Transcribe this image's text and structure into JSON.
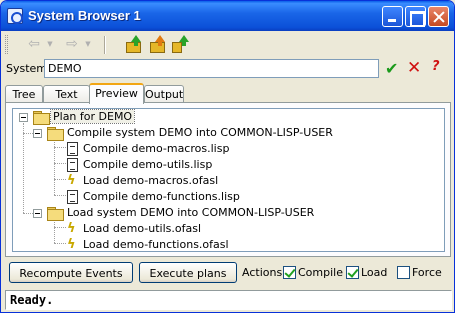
{
  "window": {
    "title": "System Browser 1"
  },
  "toolbar": {
    "back_icon": "back-arrow-icon",
    "forward_icon": "forward-arrow-icon",
    "tools": [
      "compile-system-icon",
      "load-system-icon",
      "compile-load-icon"
    ]
  },
  "system": {
    "label": "System:",
    "value": "DEMO"
  },
  "tabs": [
    {
      "label": "Tree",
      "active": false
    },
    {
      "label": "Text",
      "active": false
    },
    {
      "label": "Preview",
      "active": true
    },
    {
      "label": "Output",
      "active": false
    }
  ],
  "plan": {
    "root": "Plan for DEMO",
    "groups": [
      {
        "label": "Compile system DEMO into COMMON-LISP-USER",
        "items": [
          {
            "label": "Compile demo-macros.lisp",
            "kind": "compile"
          },
          {
            "label": "Compile demo-utils.lisp",
            "kind": "compile"
          },
          {
            "label": "Load demo-macros.ofasl",
            "kind": "load"
          },
          {
            "label": "Compile demo-functions.lisp",
            "kind": "compile"
          }
        ]
      },
      {
        "label": "Load system DEMO into COMMON-LISP-USER",
        "items": [
          {
            "label": "Load demo-utils.ofasl",
            "kind": "load"
          },
          {
            "label": "Load demo-functions.ofasl",
            "kind": "load"
          }
        ]
      }
    ]
  },
  "buttons": {
    "recompute": "Recompute Events",
    "execute": "Execute plans"
  },
  "actions": {
    "label": "Actions:",
    "compile": {
      "label": "Compile",
      "checked": true
    },
    "load": {
      "label": "Load",
      "checked": true
    },
    "force": {
      "label": "Force",
      "checked": false
    }
  },
  "status": "Ready.",
  "colors": {
    "titlebar": "#0b50d8",
    "check": "#1b9a1b",
    "cancel": "#d01010",
    "active_tab": "#f2a614"
  }
}
